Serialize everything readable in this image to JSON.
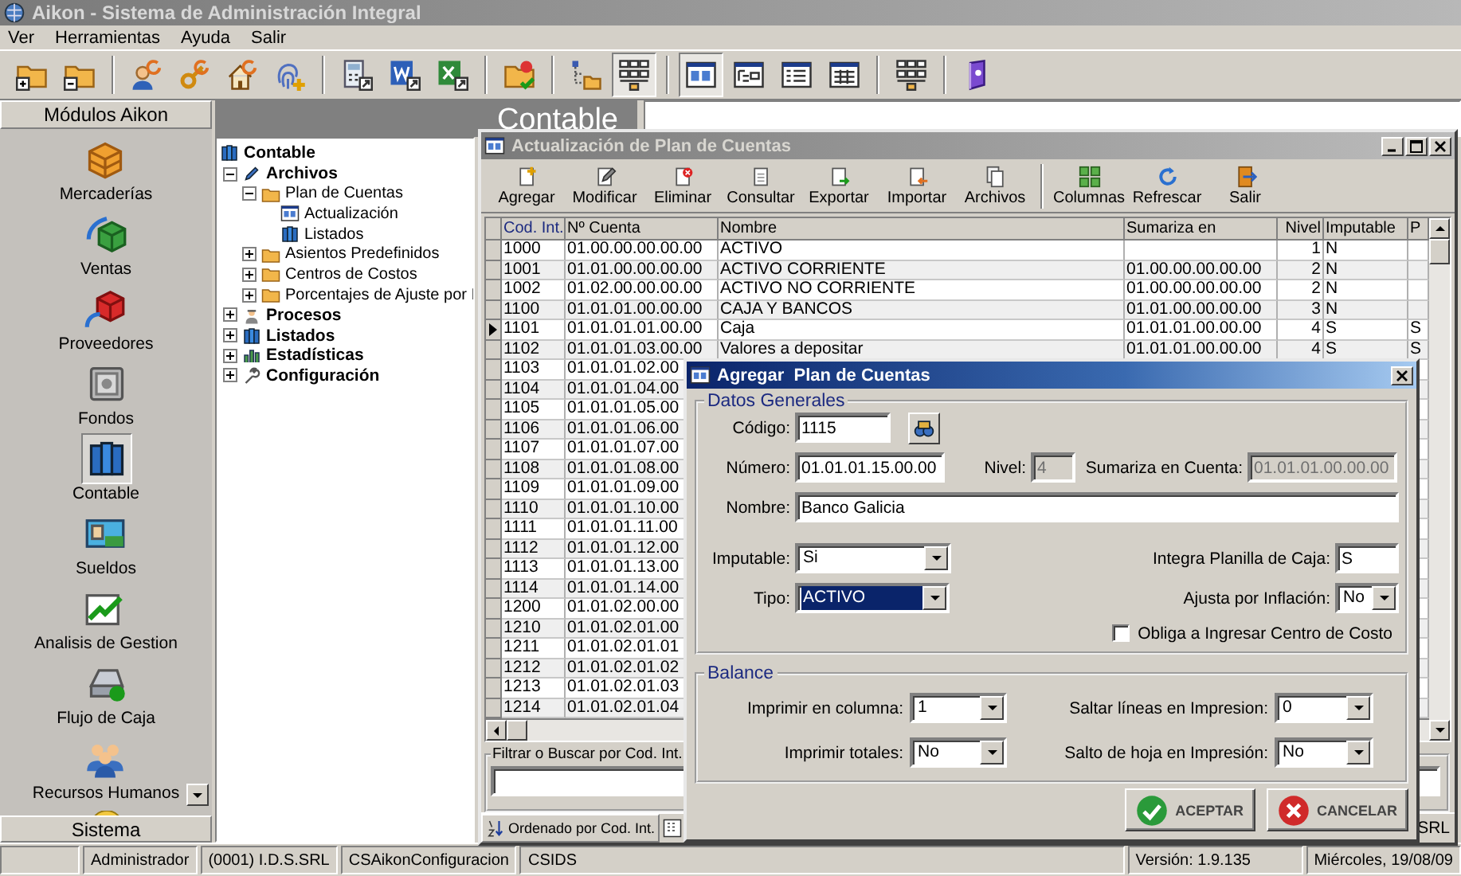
{
  "window": {
    "title": "Aikon - Sistema de Administración Integral"
  },
  "menu": [
    "Ver",
    "Herramientas",
    "Ayuda",
    "Salir"
  ],
  "toolbar": [
    {
      "kind": "folder-plus",
      "pressed": false
    },
    {
      "kind": "folder-minus",
      "pressed": false
    },
    {
      "kind": "separator"
    },
    {
      "kind": "user",
      "pressed": false
    },
    {
      "kind": "key",
      "pressed": false
    },
    {
      "kind": "home",
      "pressed": false
    },
    {
      "kind": "fingerprint",
      "pressed": false
    },
    {
      "kind": "separator"
    },
    {
      "kind": "calculator",
      "pressed": false
    },
    {
      "kind": "word",
      "pressed": false
    },
    {
      "kind": "excel",
      "pressed": false
    },
    {
      "kind": "separator"
    },
    {
      "kind": "folder-check",
      "pressed": false
    },
    {
      "kind": "separator"
    },
    {
      "kind": "tree",
      "pressed": false
    },
    {
      "kind": "grid",
      "pressed": true
    },
    {
      "kind": "separator"
    },
    {
      "kind": "window",
      "pressed": true
    },
    {
      "kind": "window-tree",
      "pressed": false
    },
    {
      "kind": "window-list",
      "pressed": false
    },
    {
      "kind": "window-table",
      "pressed": false
    },
    {
      "kind": "separator"
    },
    {
      "kind": "grid",
      "pressed": false
    },
    {
      "kind": "separator"
    },
    {
      "kind": "book",
      "pressed": false
    }
  ],
  "sidebar": {
    "title": "Módulos Aikon",
    "items": [
      {
        "label": "Mercaderías",
        "kind": "boxes",
        "selected": false
      },
      {
        "label": "Ventas",
        "kind": "box-green",
        "selected": false
      },
      {
        "label": "Proveedores",
        "kind": "box-red",
        "selected": false
      },
      {
        "label": "Fondos",
        "kind": "safe",
        "selected": false
      },
      {
        "label": "Contable",
        "kind": "books",
        "selected": true
      },
      {
        "label": "Sueldos",
        "kind": "idcard",
        "selected": false
      },
      {
        "label": "Analisis de Gestion",
        "kind": "chart",
        "selected": false
      },
      {
        "label": "Flujo de Caja",
        "kind": "register",
        "selected": false
      },
      {
        "label": "Recursos Humanos",
        "kind": "people",
        "selected": false
      }
    ],
    "footer": "Sistema"
  },
  "module_title": "Contable",
  "tree": [
    {
      "label": "Contable",
      "kind": "books",
      "children": [
        {
          "label": "Archivos",
          "kind": "pencil",
          "expanded": true,
          "children": [
            {
              "label": "Plan de Cuentas",
              "kind": "folder",
              "expanded": true,
              "children": [
                {
                  "label": "Actualización",
                  "kind": "window"
                },
                {
                  "label": "Listados",
                  "kind": "books"
                }
              ]
            },
            {
              "label": "Asientos Predefinidos",
              "kind": "folder",
              "expanded": false
            },
            {
              "label": "Centros de Costos",
              "kind": "folder",
              "expanded": false
            },
            {
              "label": "Porcentajes de Ajuste por I",
              "kind": "folder",
              "expanded": false
            }
          ]
        },
        {
          "label": "Procesos",
          "kind": "person",
          "expanded": false
        },
        {
          "label": "Listados",
          "kind": "books",
          "expanded": false
        },
        {
          "label": "Estadísticas",
          "kind": "barchart",
          "expanded": false
        },
        {
          "label": "Configuración",
          "kind": "wrench",
          "expanded": false
        }
      ]
    }
  ],
  "child_window": {
    "title": "Actualización de Plan de Cuentas",
    "toolbar": [
      {
        "label": "Agregar",
        "kind": "add"
      },
      {
        "label": "Modificar",
        "kind": "edit"
      },
      {
        "label": "Eliminar",
        "kind": "delete"
      },
      {
        "label": "Consultar",
        "kind": "consult"
      },
      {
        "label": "Exportar",
        "kind": "export"
      },
      {
        "label": "Importar",
        "kind": "import"
      },
      {
        "label": "Archivos",
        "kind": "archive"
      },
      {
        "kind": "separator"
      },
      {
        "label": "Columnas",
        "kind": "columns"
      },
      {
        "label": "Refrescar",
        "kind": "refresh"
      },
      {
        "label": "Salir",
        "kind": "exit"
      }
    ],
    "grid": {
      "columns": [
        "Cod. Int.",
        "Nº Cuenta",
        "Nombre",
        "Sumariza en",
        "Nivel",
        "Imputable",
        "P"
      ],
      "rows": [
        {
          "cod_int": "1000",
          "cuenta": "01.00.00.00.00.00",
          "nombre": "ACTIVO",
          "nivel": "1",
          "imputable": "N",
          "selected": false
        },
        {
          "cod_int": "1001",
          "cuenta": "01.01.00.00.00.00",
          "nombre": "ACTIVO CORRIENTE",
          "sumariza_en": "01.00.00.00.00.00",
          "nivel": "2",
          "imputable": "N",
          "selected": false
        },
        {
          "cod_int": "1002",
          "cuenta": "01.02.00.00.00.00",
          "nombre": "ACTIVO NO CORRIENTE",
          "sumariza_en": "01.00.00.00.00.00",
          "nivel": "2",
          "imputable": "N",
          "selected": false
        },
        {
          "cod_int": "1100",
          "cuenta": "01.01.01.00.00.00",
          "nombre": "CAJA Y BANCOS",
          "sumariza_en": "01.01.00.00.00.00",
          "nivel": "3",
          "imputable": "N",
          "selected": false
        },
        {
          "cod_int": "1101",
          "cuenta": "01.01.01.01.00.00",
          "nombre": "Caja",
          "sumariza_en": "01.01.01.00.00.00",
          "nivel": "4",
          "imputable": "S",
          "p": "S",
          "selected": true
        },
        {
          "cod_int": "1102",
          "cuenta": "01.01.01.03.00.00",
          "nombre": "Valores a depositar",
          "sumariza_en": "01.01.01.00.00.00",
          "nivel": "4",
          "imputable": "S",
          "p": "S",
          "selected": false
        },
        {
          "cod_int": "1103",
          "cuenta": "01.01.01.02.00",
          "selected": false
        },
        {
          "cod_int": "1104",
          "cuenta": "01.01.01.04.00",
          "selected": false
        },
        {
          "cod_int": "1105",
          "cuenta": "01.01.01.05.00",
          "selected": false
        },
        {
          "cod_int": "1106",
          "cuenta": "01.01.01.06.00",
          "selected": false
        },
        {
          "cod_int": "1107",
          "cuenta": "01.01.01.07.00",
          "selected": false
        },
        {
          "cod_int": "1108",
          "cuenta": "01.01.01.08.00",
          "selected": false
        },
        {
          "cod_int": "1109",
          "cuenta": "01.01.01.09.00",
          "selected": false
        },
        {
          "cod_int": "1110",
          "cuenta": "01.01.01.10.00",
          "selected": false
        },
        {
          "cod_int": "1111",
          "cuenta": "01.01.01.11.00",
          "selected": false
        },
        {
          "cod_int": "1112",
          "cuenta": "01.01.01.12.00",
          "selected": false
        },
        {
          "cod_int": "1113",
          "cuenta": "01.01.01.13.00",
          "selected": false
        },
        {
          "cod_int": "1114",
          "cuenta": "01.01.01.14.00",
          "selected": false
        },
        {
          "cod_int": "1200",
          "cuenta": "01.01.02.00.00",
          "selected": false
        },
        {
          "cod_int": "1210",
          "cuenta": "01.01.02.01.00",
          "selected": false
        },
        {
          "cod_int": "1211",
          "cuenta": "01.01.02.01.01",
          "selected": false
        },
        {
          "cod_int": "1212",
          "cuenta": "01.01.02.01.02",
          "selected": false
        },
        {
          "cod_int": "1213",
          "cuenta": "01.01.02.01.03",
          "selected": false
        },
        {
          "cod_int": "1214",
          "cuenta": "01.01.02.01.04",
          "selected": false
        }
      ]
    },
    "filter": {
      "label": "Filtrar o Buscar por Cod. Int."
    },
    "sort_label": "Ordenado por Cod. Int.",
    "status_text": "SRL"
  },
  "dialog": {
    "title": "Agregar  Plan de Cuentas",
    "general": {
      "legend": "Datos Generales",
      "codigo": {
        "label": "Código:",
        "value": "1115"
      },
      "numero": {
        "label": "Número:",
        "value": "01.01.01.15.00.00"
      },
      "nivel": {
        "label": "Nivel:",
        "value": "4",
        "disabled": true
      },
      "sumariza": {
        "label": "Sumariza en Cuenta:",
        "value": "01.01.01.00.00.00",
        "disabled": true
      },
      "nombre": {
        "label": "Nombre:",
        "value": "Banco Galicia"
      },
      "imputable": {
        "label": "Imputable:",
        "value": "Si"
      },
      "integra": {
        "label": "Integra Planilla de Caja:",
        "value": "S"
      },
      "tipo": {
        "label": "Tipo:",
        "value": "ACTIVO",
        "focused": true
      },
      "ajusta": {
        "label": "Ajusta por Inflación:",
        "value": "No"
      },
      "obliga": {
        "label": "Obliga a Ingresar Centro de Costo",
        "checked": false
      }
    },
    "balance": {
      "legend": "Balance",
      "fields": [
        {
          "label": "Imprimir en columna:",
          "value": "1"
        },
        {
          "label": "Saltar líneas en Impresion:",
          "value": "0"
        },
        {
          "label": "Imprimir totales:",
          "value": "No"
        },
        {
          "label": "Salto de hoja en Impresión:",
          "value": "No"
        }
      ]
    },
    "buttons": [
      {
        "label": "ACEPTAR",
        "kind": "ok"
      },
      {
        "label": "CANCELAR",
        "kind": "cancel"
      }
    ]
  },
  "status_bar": {
    "left": [
      "Administrador",
      "(0001) I.D.S.SRL",
      "CSAikonConfiguracion",
      "CSIDS"
    ],
    "right": [
      "Versión: 1.9.135",
      "Miércoles, 19/08/09"
    ]
  }
}
